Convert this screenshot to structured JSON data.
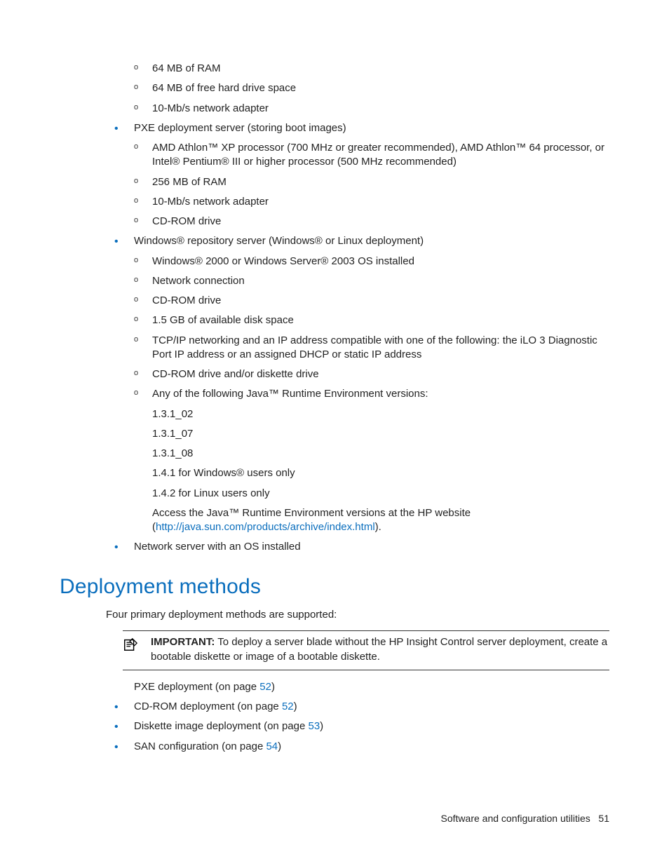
{
  "top_list": [
    {
      "text": null,
      "sub": [
        {
          "text": "64 MB of RAM"
        },
        {
          "text": "64 MB of free hard drive space"
        },
        {
          "text": "10-Mb/s network adapter"
        }
      ]
    },
    {
      "text": "PXE deployment server (storing boot images)",
      "sub": [
        {
          "text": "AMD Athlon™ XP processor (700 MHz or greater recommended), AMD Athlon™ 64 processor, or Intel® Pentium® III or higher processor (500 MHz recommended)"
        },
        {
          "text": "256 MB of RAM"
        },
        {
          "text": "10-Mb/s network adapter"
        },
        {
          "text": "CD-ROM drive"
        }
      ]
    },
    {
      "text": "Windows® repository server (Windows® or Linux deployment)",
      "sub": [
        {
          "text": "Windows® 2000 or Windows Server® 2003 OS installed"
        },
        {
          "text": "Network connection"
        },
        {
          "text": "CD-ROM drive"
        },
        {
          "text": "1.5 GB of available disk space"
        },
        {
          "text": "TCP/IP networking and an IP address compatible with one of the following: the iLO 3 Diagnostic Port IP address or an assigned DHCP or static IP address"
        },
        {
          "text": "CD-ROM drive and/or diskette drive"
        },
        {
          "text": "Any of the following Java™ Runtime Environment versions:",
          "lines": [
            "1.3.1_02",
            "1.3.1_07",
            "1.3.1_08",
            "1.4.1 for Windows® users only",
            "1.4.2 for Linux users only"
          ],
          "tail_pre": "Access the Java™ Runtime Environment versions at the HP website (",
          "tail_link": "http://java.sun.com/products/archive/index.html",
          "tail_post": ")."
        }
      ]
    },
    {
      "text": "Network server with an OS installed"
    }
  ],
  "section_heading": "Deployment methods",
  "intro": "Four primary deployment methods are supported:",
  "callout": {
    "label": "IMPORTANT:",
    "text": "   To deploy a server blade without the HP Insight Control server deployment, create a bootable diskette or image of a bootable diskette."
  },
  "methods": [
    {
      "pre": "PXE deployment (on page ",
      "link": "52",
      "post": ")"
    },
    {
      "pre": "CD-ROM deployment (on page ",
      "link": "52",
      "post": ")"
    },
    {
      "pre": "Diskette image deployment (on page ",
      "link": "53",
      "post": ")"
    },
    {
      "pre": "SAN configuration (on page ",
      "link": "54",
      "post": ")"
    }
  ],
  "footer": {
    "text": "Software and configuration utilities",
    "page": "51"
  }
}
